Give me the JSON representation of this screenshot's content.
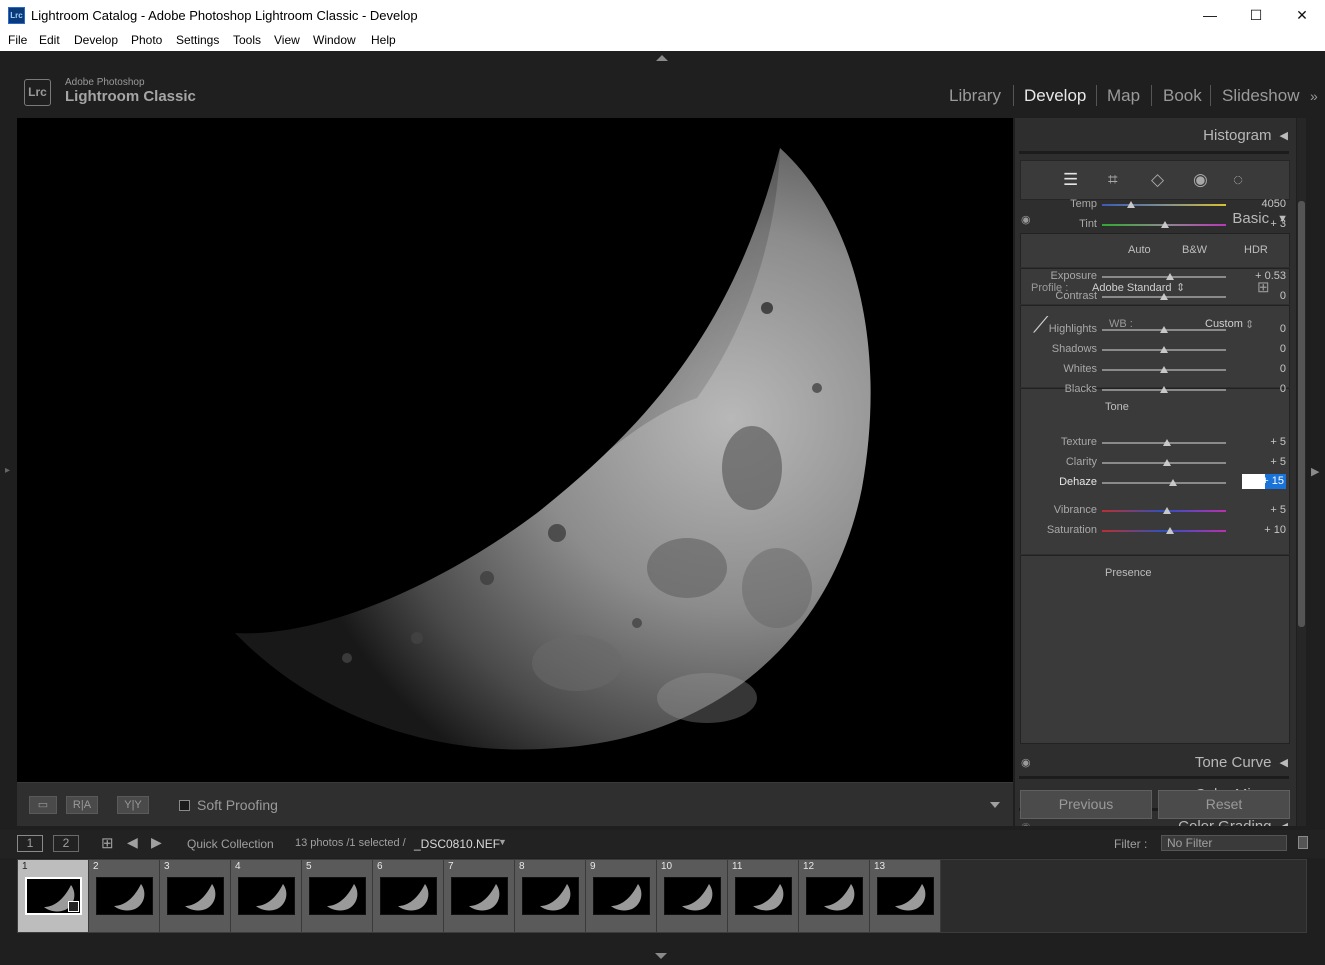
{
  "window": {
    "title": "Lightroom Catalog - Adobe Photoshop Lightroom Classic - Develop",
    "app_icon": "Lrc",
    "minimize": "—",
    "maximize": "☐",
    "close": "✕"
  },
  "menu": [
    "File",
    "Edit",
    "Develop",
    "Photo",
    "Settings",
    "Tools",
    "View",
    "Window",
    "Help"
  ],
  "brand": {
    "logo": "Lrc",
    "line1": "Adobe Photoshop",
    "line2": "Lightroom Classic"
  },
  "modules": {
    "items": [
      "Library",
      "Develop",
      "Map",
      "Book",
      "Slideshow"
    ],
    "active": "Develop",
    "more": "»"
  },
  "toolbar": {
    "loupe": "▭",
    "ra": "R|A",
    "yy": "Y|Y",
    "soft_proofing": "Soft Proofing"
  },
  "panels": {
    "histogram": "Histogram",
    "basic": {
      "title": "Basic",
      "auto": "Auto",
      "bw": "B&W",
      "hdr": "HDR",
      "profile_label": "Profile :",
      "profile_value": "Adobe Standard",
      "wb_label": "WB :",
      "wb_value": "Custom",
      "tone_label": "Tone",
      "presence_label": "Presence",
      "sliders": [
        {
          "label": "Temp",
          "value": "4050",
          "pos": 0.23
        },
        {
          "label": "Tint",
          "value": "+ 3",
          "pos": 0.51
        },
        {
          "label": "Exposure",
          "value": "+ 0.53",
          "pos": 0.55
        },
        {
          "label": "Contrast",
          "value": "0",
          "pos": 0.5
        },
        {
          "label": "Highlights",
          "value": "0",
          "pos": 0.5
        },
        {
          "label": "Shadows",
          "value": "0",
          "pos": 0.5
        },
        {
          "label": "Whites",
          "value": "0",
          "pos": 0.5
        },
        {
          "label": "Blacks",
          "value": "0",
          "pos": 0.5
        },
        {
          "label": "Texture",
          "value": "+ 5",
          "pos": 0.525
        },
        {
          "label": "Clarity",
          "value": "+ 5",
          "pos": 0.525
        },
        {
          "label": "Dehaze",
          "value": "+ 15",
          "pos": 0.575
        },
        {
          "label": "Vibrance",
          "value": "+ 5",
          "pos": 0.525
        },
        {
          "label": "Saturation",
          "value": "+ 10",
          "pos": 0.55
        }
      ]
    },
    "tone_curve": "Tone Curve",
    "color_mixer": "Color Mixer",
    "color_grading": "Color Grading"
  },
  "buttons": {
    "previous": "Previous",
    "reset": "Reset"
  },
  "filmstrip": {
    "view1": "1",
    "view2": "2",
    "source": "Quick Collection",
    "info": "13 photos /1 selected /",
    "filename": "_DSC0810.NEF",
    "filter_label": "Filter :",
    "filter_value": "No Filter",
    "thumbs": [
      "1",
      "2",
      "3",
      "4",
      "5",
      "6",
      "7",
      "8",
      "9",
      "10",
      "11",
      "12",
      "13"
    ],
    "selected_index": 0
  }
}
